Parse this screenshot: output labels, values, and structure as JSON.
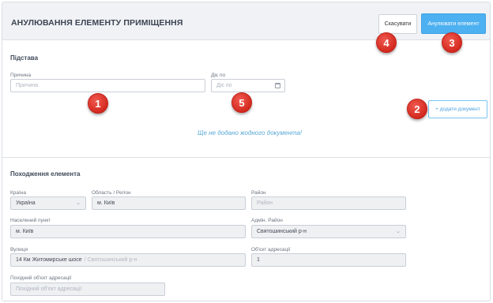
{
  "header": {
    "title": "АНУЛЮВАННЯ ЕЛЕМЕНТУ ПРИМІЩЕННЯ",
    "cancel_label": "Скасувати",
    "annul_label": "Анулювати елемент"
  },
  "basis": {
    "section_title": "Підстава",
    "reason_label": "Причина",
    "reason_placeholder": "Причина",
    "valid_until_label": "Діє по",
    "valid_until_placeholder": "Діє по",
    "add_document_label": "+ додати документ",
    "empty_message": "Ще не додано жодного документа!"
  },
  "origin": {
    "section_title": "Походження елемента",
    "country_label": "Країна",
    "country_value": "Україна",
    "region_label": "Область / Регіон",
    "region_value": "м. Київ",
    "district_label": "Район",
    "district_placeholder": "Район",
    "settlement_label": "Населений пункт",
    "settlement_value": "м. Київ",
    "admin_district_label": "Адмін. Район",
    "admin_district_value": "Святошинський р-н",
    "street_label": "Вулиця",
    "street_value": "14 Км Житомирське шосе",
    "street_suffix": "/ Святошинський р-н",
    "address_object_label": "Об'єкт адресації",
    "address_object_value": "1",
    "derived_address_object_label": "Похідний об'єкт адресації",
    "derived_address_object_placeholder": "Похідний об'єкт адресації"
  },
  "markers": [
    "1",
    "2",
    "3",
    "4",
    "5"
  ],
  "colors": {
    "accent": "#4db0f0",
    "marker": "#d42a20",
    "header_bg": "#f0f2f5"
  }
}
